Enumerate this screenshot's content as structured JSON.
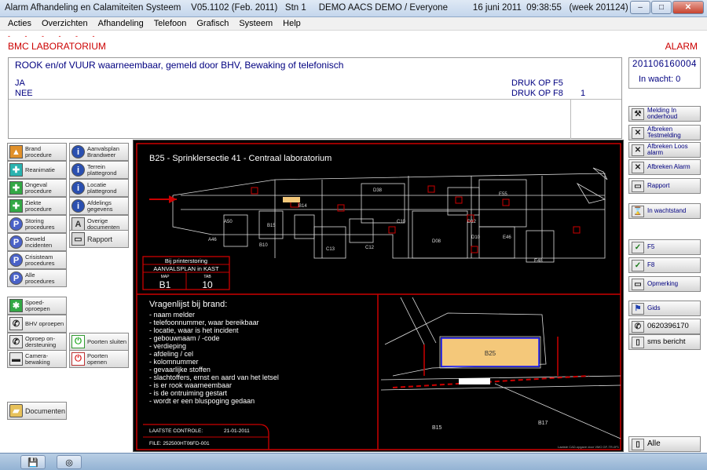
{
  "window": {
    "title": "Alarm Afhandeling en Calamiteiten Systeem    V05.1102 (Feb. 2011)   Stn 1     DEMO AACS DEMO / Everyone          16 juni 2011  09:38:55   (week 201124)",
    "btn_min": "–",
    "btn_max": "□",
    "btn_close": "✕"
  },
  "menu": [
    "Acties",
    "Overzichten",
    "Afhandeling",
    "Telefoon",
    "Grafisch",
    "Systeem",
    "Help"
  ],
  "header": {
    "dots": "- - - - - -",
    "location": "BMC  LABORATORIUM",
    "alarm": "ALARM"
  },
  "message": {
    "title": "ROOK en/of VUUR waarneembaar, gemeld door BHV, Bewaking of telefonisch",
    "options": [
      {
        "label": "JA",
        "druk": "DRUK OP  F5",
        "count": ""
      },
      {
        "label": "NEE",
        "druk": "DRUK OP  F8",
        "count": "1"
      }
    ]
  },
  "id_panel": {
    "number": "201106160004",
    "waiting": "In wacht:  0"
  },
  "left_col1": [
    {
      "label": "Brand procedure",
      "icon": "fire-icon",
      "glyph": "▲"
    },
    {
      "label": "Reanimatie",
      "icon": "medical-icon",
      "glyph": "✚"
    },
    {
      "label": "Ongeval procedure",
      "icon": "first-aid-icon",
      "glyph": "✚"
    },
    {
      "label": "Ziekte procedure",
      "icon": "first-aid-icon",
      "glyph": "✚"
    },
    {
      "label": "Storing procedures",
      "icon": "p-icon",
      "glyph": "P"
    },
    {
      "label": "Geweld incidenten",
      "icon": "p-icon",
      "glyph": "P"
    },
    {
      "label": "Crisisteam procedures",
      "icon": "p-icon",
      "glyph": "P"
    },
    {
      "label": "Alle procedures",
      "icon": "p-icon",
      "glyph": "P"
    }
  ],
  "left_col2": [
    {
      "label": "Aanvalsplan Brandweer",
      "icon": "info-icon",
      "glyph": "i"
    },
    {
      "label": "Terrein plattegrond",
      "icon": "info-icon",
      "glyph": "i"
    },
    {
      "label": "Locatie plattegrond",
      "icon": "info-icon",
      "glyph": "i"
    },
    {
      "label": "Afdelings gegevens",
      "icon": "info-icon",
      "glyph": "i"
    },
    {
      "label": "Overige documenten",
      "icon": "sort-icon",
      "glyph": "A"
    },
    {
      "label": "Rapport",
      "icon": "report-icon",
      "glyph": "▭"
    }
  ],
  "left_comm": [
    {
      "label": "Spoed- oproepen",
      "icon": "emergency-icon",
      "glyph": "✱"
    },
    {
      "label": "BHV oproepen",
      "icon": "phone-icon",
      "glyph": "✆"
    },
    {
      "label": "Oproep on- dersteuning",
      "icon": "phone-icon",
      "glyph": "✆"
    },
    {
      "label": "Camera- bewaking",
      "icon": "camera-icon",
      "glyph": "▬"
    }
  ],
  "gates": [
    {
      "label": "Poorten sluiten",
      "icon": "power-icon",
      "glyph": "⏻"
    },
    {
      "label": "Poorten openen",
      "icon": "power-icon",
      "glyph": "⏻"
    }
  ],
  "documents_button": {
    "label": "Documenten",
    "icon": "folder-icon",
    "glyph": "▰"
  },
  "right_buttons": [
    {
      "label": "Melding In onderhoud",
      "icon": "wrench-icon",
      "glyph": "⚒"
    },
    {
      "label": "Afbreken Testmelding",
      "icon": "cancel-icon",
      "glyph": "✕"
    },
    {
      "label": "Afbreken Loos alarm",
      "icon": "cancel-icon",
      "glyph": "✕"
    },
    {
      "label": "Afbreken Alarm",
      "icon": "cancel-icon",
      "glyph": "✕"
    },
    {
      "label": "Rapport",
      "icon": "report-icon",
      "glyph": "▭"
    },
    {
      "label": "In wachtstand",
      "icon": "hold-icon",
      "glyph": "⌛"
    },
    {
      "label": "F5",
      "icon": "check-icon",
      "glyph": "✓"
    },
    {
      "label": "F8",
      "icon": "check-icon",
      "glyph": "✓"
    },
    {
      "label": "Opmerking",
      "icon": "note-icon",
      "glyph": "▭"
    },
    {
      "label": "Gids",
      "icon": "guide-icon",
      "glyph": "⚑"
    },
    {
      "label": "0620396170",
      "icon": "phone-icon",
      "glyph": "✆"
    },
    {
      "label": "sms bericht",
      "icon": "sms-icon",
      "glyph": "▯"
    },
    {
      "label": "Alle",
      "icon": "all-icon",
      "glyph": "▯"
    }
  ],
  "drawing": {
    "title": "B25 - Sprinklersectie 41 - Centraal laboratorium",
    "room_labels": [
      "D38",
      "E55",
      "B14",
      "A50",
      "B15",
      "B10",
      "A46",
      "C13",
      "C12",
      "C10",
      "D08",
      "D10",
      "E46",
      "E48",
      "D12"
    ],
    "storing": {
      "title": "Bij printerstoring",
      "subtitle": "AANVALSPLAN in KAST",
      "map_label": "MAP",
      "map_value": "B1",
      "tab_label": "TAB",
      "tab_value": "10"
    },
    "question_title": "Vragenlijst bij brand:",
    "questions": [
      "- naam melder",
      "- telefoonnummer, waar bereikbaar",
      "- locatie, waar is het incident",
      "- gebouwnaam / -code",
      "- verdieping",
      "- afdeling / cel",
      "- kolomnummer",
      "- gevaarlijke stoffen",
      "- slachtoffers, ernst en aard van het letsel",
      "- is er rook waarneembaar",
      "- is de ontruiming gestart",
      "- wordt er een bluspoging gedaan"
    ],
    "last_check_label": "LAATSTE CONTROLE:",
    "last_check_date": "21-01-2011",
    "file": "FILE: 252500HT06FD-001",
    "map_building": "B25",
    "map_labels": [
      "B15",
      "B17"
    ],
    "footer_note": "Laatste CAD-opgave door VMO   GF-TR-0F1"
  },
  "taskbar": [
    {
      "icon": "save-icon",
      "glyph": "💾"
    },
    {
      "icon": "app-icon",
      "glyph": "◎"
    }
  ]
}
